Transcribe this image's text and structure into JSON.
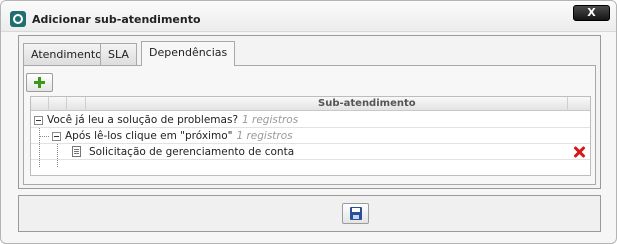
{
  "window": {
    "title": "Adicionar sub-atendimento",
    "close_label": "X"
  },
  "tabs": [
    {
      "label": "Atendimento"
    },
    {
      "label": "SLA"
    },
    {
      "label": "Dependências"
    }
  ],
  "active_tab": "Dependências",
  "grid": {
    "column_header": "Sub-atendimento",
    "rows": [
      {
        "text": "Você já leu a solução de problemas?",
        "count": "1 registros"
      },
      {
        "text": "Após lê-los clique em \"próximo\"",
        "count": "1 registros"
      },
      {
        "text": "Solicitação de gerenciamento de conta"
      }
    ]
  },
  "icons": {
    "add": "plus-icon",
    "delete": "delete-icon",
    "save": "save-icon",
    "document": "document-icon"
  },
  "colors": {
    "add_green": "#3a9a18",
    "delete_red": "#d81818",
    "save_blue": "#2a4f9a"
  }
}
